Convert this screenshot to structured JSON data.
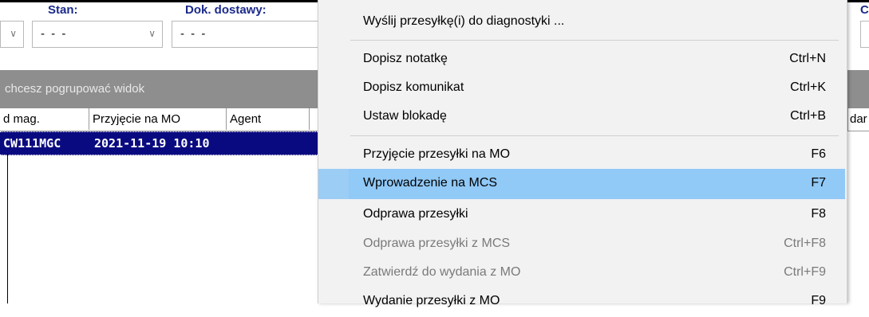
{
  "filters": {
    "stan_label": "Stan:",
    "stan_value": "- - -",
    "dok_label": "Dok. dostawy:",
    "dok_value": "- - -",
    "right_label": "C"
  },
  "grouping_hint": "chcesz pogrupować widok",
  "table": {
    "headers": [
      "d mag.",
      "Przyjęcie na MO",
      "Agent"
    ],
    "right_header": "dar",
    "rows": [
      {
        "cells": [
          "CW111MGC",
          "2021-11-19 10:10",
          ""
        ],
        "selected": true
      }
    ]
  },
  "context_menu": {
    "items": [
      {
        "label": "Wyślij przesyłkę(i) do diagnostyki ...",
        "shortcut": "",
        "enabled": true
      },
      {
        "label": "Dopisz notatkę",
        "shortcut": "Ctrl+N",
        "enabled": true
      },
      {
        "label": "Dopisz komunikat",
        "shortcut": "Ctrl+K",
        "enabled": true
      },
      {
        "label": "Ustaw blokadę",
        "shortcut": "Ctrl+B",
        "enabled": true
      },
      {
        "label": "Przyjęcie przesyłki na MO",
        "shortcut": "F6",
        "enabled": true
      },
      {
        "label": "Wprowadzenie na MCS",
        "shortcut": "F7",
        "enabled": true,
        "highlighted": true
      },
      {
        "label": "Odprawa przesyłki",
        "shortcut": "F8",
        "enabled": true
      },
      {
        "label": "Odprawa przesyłki z MCS",
        "shortcut": "Ctrl+F8",
        "enabled": false
      },
      {
        "label": "Zatwierdź do wydania z MO",
        "shortcut": "Ctrl+F9",
        "enabled": false
      },
      {
        "label": "Wydanie przesyłki z MO",
        "shortcut": "F9",
        "enabled": true
      }
    ]
  },
  "colors": {
    "selection_row": "#0a0a80",
    "menu_highlight": "#91c9f7",
    "label_blue": "#1a2a8c"
  }
}
